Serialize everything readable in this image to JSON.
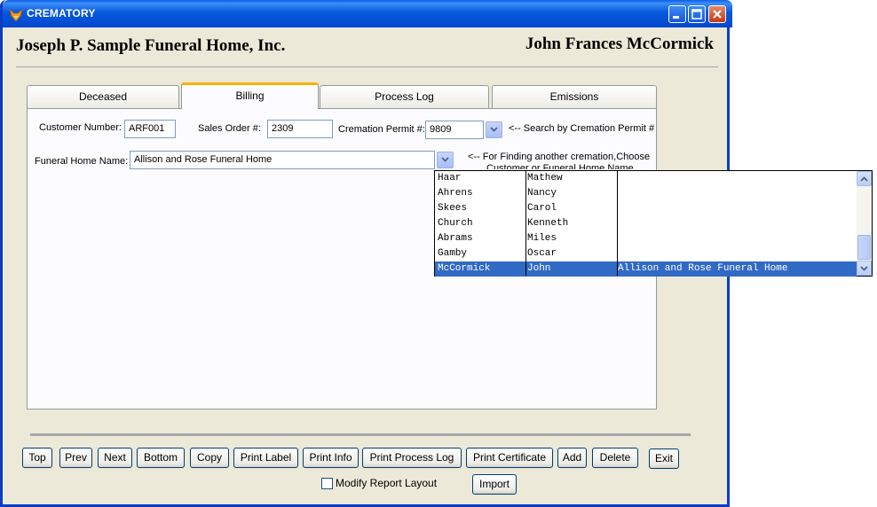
{
  "window": {
    "title": "CREMATORY",
    "colors": {
      "titlebar": "#0A5FEA",
      "face": "#ECE9D8",
      "selection": "#316AC5",
      "tab_highlight": "#F5B400"
    }
  },
  "header": {
    "home_name": "Joseph P. Sample Funeral Home, Inc.",
    "person_name": "John Frances McCormick"
  },
  "tabs": [
    {
      "label": "Deceased"
    },
    {
      "label": "Billing",
      "active": true
    },
    {
      "label": "Process Log"
    },
    {
      "label": "Emissions"
    }
  ],
  "billing": {
    "customer_number_label": "Customer Number:",
    "customer_number_value": "ARF001",
    "sales_order_label": "Sales Order #:",
    "sales_order_value": "2309",
    "cremation_permit_label": "Cremation Permit #:",
    "cremation_permit_value": "9809",
    "permit_hint": "<-- Search by Cremation Permit #",
    "funeral_home_label": "Funeral Home Name:",
    "funeral_home_value": "Allison and Rose Funeral Home",
    "funeral_home_hint_line1": "<-- For Finding another cremation,Choose",
    "funeral_home_hint_line2": "Customer or Funeral Home Name"
  },
  "dropdown": {
    "rows": [
      {
        "last": "Haar",
        "first": "Mathew",
        "home": ""
      },
      {
        "last": "Ahrens",
        "first": "Nancy",
        "home": ""
      },
      {
        "last": "Skees",
        "first": "Carol",
        "home": ""
      },
      {
        "last": "Church",
        "first": "Kenneth",
        "home": ""
      },
      {
        "last": "Abrams",
        "first": "Miles",
        "home": ""
      },
      {
        "last": "Gamby",
        "first": "Oscar",
        "home": ""
      },
      {
        "last": "McCormick",
        "first": "John",
        "home": "Allison and Rose Funeral Home",
        "selected": true
      }
    ]
  },
  "buttons": {
    "top": "Top",
    "prev": "Prev",
    "next": "Next",
    "bottom": "Bottom",
    "copy": "Copy",
    "print_label": "Print Label",
    "print_info": "Print Info",
    "print_process_log": "Print Process Log",
    "print_certificate": "Print Certificate",
    "add": "Add",
    "delete": "Delete",
    "exit": "Exit",
    "import": "Import"
  },
  "options": {
    "modify_report_layout": "Modify Report Layout",
    "modify_report_layout_checked": false
  },
  "icons": {
    "app": "fox-icon",
    "minimize": "minimize-icon",
    "maximize": "maximize-icon",
    "close": "close-icon",
    "dropdown": "chevron-down-icon",
    "scroll_up": "scroll-up-arrow-icon",
    "scroll_down": "scroll-down-arrow-icon"
  }
}
